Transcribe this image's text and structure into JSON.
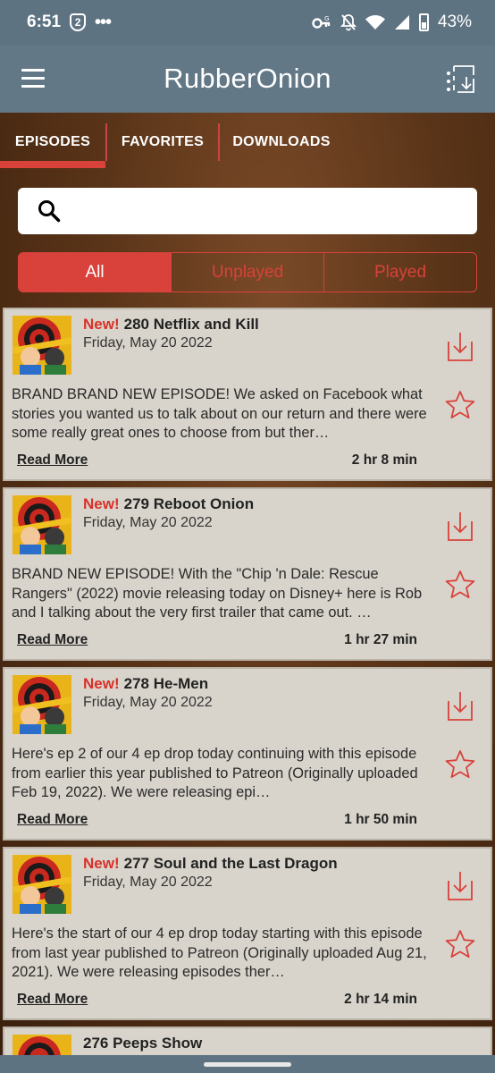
{
  "status_bar": {
    "time": "6:51",
    "badge": "2",
    "dots": "•••",
    "battery": "43%"
  },
  "app_bar": {
    "title": "RubberOnion"
  },
  "tabs": [
    {
      "label": "EPISODES",
      "active": true
    },
    {
      "label": "FAVORITES",
      "active": false
    },
    {
      "label": "DOWNLOADS",
      "active": false
    }
  ],
  "search": {
    "placeholder": ""
  },
  "filter": [
    {
      "label": "All",
      "active": true
    },
    {
      "label": "Unplayed",
      "active": false
    },
    {
      "label": "Played",
      "active": false
    }
  ],
  "episodes": [
    {
      "new_label": "New!",
      "title": "280 Netflix and Kill",
      "date": "Friday, May 20 2022",
      "description": "BRAND BRAND NEW EPISODE! We asked on Facebook what stories you wanted us to talk about on our return and there were some really great ones to choose from but ther…",
      "read_more": "Read More",
      "duration": "2 hr 8 min"
    },
    {
      "new_label": "New!",
      "title": "279 Reboot Onion",
      "date": "Friday, May 20 2022",
      "description": "BRAND NEW EPISODE! With the \"Chip 'n Dale: Rescue Rangers\" (2022) movie releasing today on Disney+ here is Rob and I talking about the very first trailer that came out. …",
      "read_more": "Read More",
      "duration": "1 hr 27 min"
    },
    {
      "new_label": "New!",
      "title": "278 He-Men",
      "date": "Friday, May 20 2022",
      "description": "Here's ep 2 of our 4 ep drop today continuing with this episode from earlier this year published to Patreon (Originally uploaded Feb 19, 2022). We were releasing epi…",
      "read_more": "Read More",
      "duration": "1 hr 50 min"
    },
    {
      "new_label": "New!",
      "title": "277 Soul and the Last Dragon",
      "date": "Friday, May 20 2022",
      "description": "Here's the start of our 4 ep drop today starting with this episode from last year published to Patreon (Originally uploaded Aug 21, 2021). We were releasing episodes ther…",
      "read_more": "Read More",
      "duration": "2 hr 14 min"
    },
    {
      "new_label": "",
      "title": "276 Peeps Show",
      "date": "",
      "description": "",
      "read_more": "",
      "duration": ""
    }
  ],
  "colors": {
    "accent": "#d9413b",
    "app_bar": "#637886",
    "status_bar": "#5e7382",
    "card": "#d8d4cb"
  }
}
